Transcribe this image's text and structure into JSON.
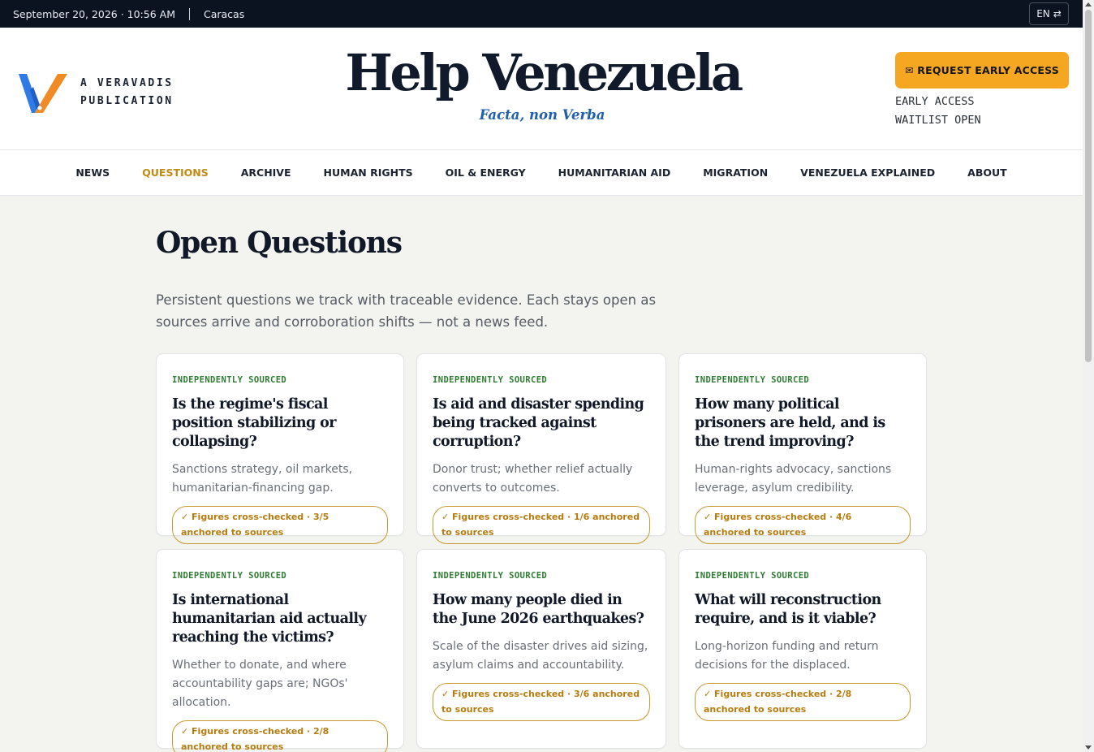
{
  "topbar": {
    "datetime": "September 20, 2026 · 10:56 AM",
    "city": "Caracas",
    "lang_label": "EN",
    "lang_icon": "⇄"
  },
  "header": {
    "brand_line1": "A VERAVADIS",
    "brand_line2": "PUBLICATION",
    "title": "Help Venezuela",
    "motto": "Facta, non Verba",
    "cta_label": "✉ REQUEST EARLY ACCESS",
    "waitlist_line1": "EARLY ACCESS",
    "waitlist_line2": "WAITLIST OPEN"
  },
  "nav": {
    "items": [
      {
        "label": "NEWS"
      },
      {
        "label": "QUESTIONS"
      },
      {
        "label": "ARCHIVE"
      },
      {
        "label": "HUMAN RIGHTS"
      },
      {
        "label": "OIL & ENERGY"
      },
      {
        "label": "HUMANITARIAN AID"
      },
      {
        "label": "MIGRATION"
      },
      {
        "label": "VENEZUELA EXPLAINED"
      },
      {
        "label": "ABOUT"
      }
    ],
    "active_label": "QUESTIONS"
  },
  "main": {
    "title": "Open Questions",
    "intro": "Persistent questions we track with traceable evidence. Each stays open as sources arrive and corroboration shifts — not a news feed.",
    "cards": [
      {
        "tag": "INDEPENDENTLY SOURCED",
        "title": "Is the regime's fiscal position stabilizing or collapsing?",
        "desc": "Sanctions strategy, oil markets, humanitarian-financing gap.",
        "badge": "✓ Figures cross-checked · 3/5 anchored to sources"
      },
      {
        "tag": "INDEPENDENTLY SOURCED",
        "title": "Is aid and disaster spending being tracked against corruption?",
        "desc": "Donor trust; whether relief actually converts to outcomes.",
        "badge": "✓ Figures cross-checked · 1/6 anchored to sources"
      },
      {
        "tag": "INDEPENDENTLY SOURCED",
        "title": "How many political prisoners are held, and is the trend improving?",
        "desc": "Human-rights advocacy, sanctions leverage, asylum credibility.",
        "badge": "✓ Figures cross-checked · 4/6 anchored to sources"
      },
      {
        "tag": "INDEPENDENTLY SOURCED",
        "title": "Is international humanitarian aid actually reaching the victims?",
        "desc": "Whether to donate, and where accountability gaps are; NGOs' allocation.",
        "badge": "✓ Figures cross-checked · 2/8 anchored to sources"
      },
      {
        "tag": "INDEPENDENTLY SOURCED",
        "title": "How many people died in the June 2026 earthquakes?",
        "desc": "Scale of the disaster drives aid sizing, asylum claims and accountability.",
        "badge": "✓ Figures cross-checked · 3/6 anchored to sources"
      },
      {
        "tag": "INDEPENDENTLY SOURCED",
        "title": "What will reconstruction require, and is it viable?",
        "desc": "Long-horizon funding and return decisions for the displaced.",
        "badge": "✓ Figures cross-checked · 2/8 anchored to sources"
      }
    ]
  },
  "colors": {
    "topbar_bg": "#0b1220",
    "accent_gold": "#f6a722",
    "active_nav": "#c28a12",
    "tag_green": "#2e7d32",
    "motto_blue": "#1f5fae",
    "logo_blue": "#2f7ae5",
    "logo_orange": "#f08a24"
  },
  "icons": {
    "logo": "veravadis-v-logo",
    "lang": "swap-arrows-icon",
    "cta": "envelope-icon",
    "badge": "checkmark-icon"
  }
}
